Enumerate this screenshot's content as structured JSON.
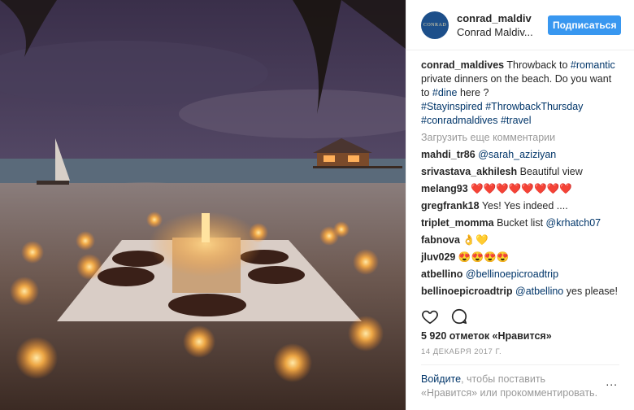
{
  "header": {
    "avatar_text": "CONRAD",
    "username": "conrad_maldiv",
    "location": "Conrad Maldiv...",
    "follow_label": "Подписаться"
  },
  "caption": {
    "user": "conrad_maldives",
    "t1": " Throwback to ",
    "tag_romantic": "#romantic",
    "t2": " private dinners on the beach. Do you want to ",
    "tag_dine": "#dine",
    "t3": " here ?",
    "tag_stay": "#Stayinspired",
    "tag_tt": "#ThrowbackThursday",
    "tag_conrad": "#conradmaldives",
    "tag_travel": "#travel"
  },
  "load_more": "Загрузить еще комментарии",
  "comments": [
    {
      "user": "mahdi_tr86",
      "mention": "@sarah_aziziyan",
      "text": ""
    },
    {
      "user": "srivastava_akhilesh",
      "mention": "",
      "text": "Beautiful view"
    },
    {
      "user": "melang93",
      "mention": "",
      "text": "❤️❤️❤️❤️❤️❤️❤️❤️"
    },
    {
      "user": "gregfrank18",
      "mention": "",
      "text": "Yes! Yes indeed ...."
    },
    {
      "user": "triplet_momma",
      "mention": "@krhatch07",
      "text": "Bucket list "
    },
    {
      "user": "fabnova",
      "mention": "",
      "text": "👌💛"
    },
    {
      "user": "jluv029",
      "mention": "",
      "text": "😍😍😍😍"
    },
    {
      "user": "atbellino",
      "mention": "@bellinoepicroadtrip",
      "text": ""
    },
    {
      "user": "bellinoepicroadtrip",
      "mention": "@atbellino",
      "text": " yes please!"
    }
  ],
  "likes": "5 920 отметок «Нравится»",
  "date": "14 ДЕКАБРЯ 2017 Г.",
  "login": {
    "link": "Войдите",
    "rest": ", чтобы поставить «Нравится» или прокомментировать.",
    "dots": "..."
  },
  "colors": {
    "accent": "#3897f0",
    "link": "#003569"
  },
  "icons": [
    "heart-icon",
    "comment-icon",
    "more-icon"
  ]
}
